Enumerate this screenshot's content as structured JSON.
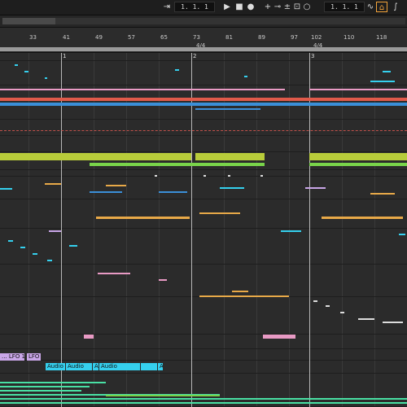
{
  "transport": {
    "position": "1. 1. 1",
    "loop_start": "1. 1. 1",
    "icons": [
      "follow-icon",
      "play-icon",
      "stop-icon",
      "record-icon",
      "add-icon",
      "link-icon",
      "plus-minus-icon",
      "capture-icon",
      "loop-icon",
      "draw-icon",
      "automation-icon"
    ]
  },
  "ruler": {
    "bars": [
      "33",
      "41",
      "49",
      "57",
      "65",
      "73",
      "81",
      "89",
      "97",
      "102",
      "110",
      "118"
    ],
    "time_signatures": [
      "4/4",
      "4/4"
    ],
    "locators": [
      "1",
      "2",
      "3"
    ]
  },
  "clips": {
    "lfo_a": "... LFO 1",
    "lfo_b": "LFO",
    "audio_1": "Audio",
    "audio_2": "Audio",
    "audio_3": "A",
    "audio_4": "Audio",
    "audio_5": "A"
  },
  "colors": {
    "lime": "#b8cc3a",
    "green": "#79d44a",
    "cyan": "#35d0ee",
    "red": "#e05a4a",
    "blue": "#3b8fd8",
    "orange": "#e8a948",
    "pink": "#e89ac4",
    "mint": "#49e0a4",
    "violet": "#c9a6e8",
    "accent": "#f2a33a"
  }
}
